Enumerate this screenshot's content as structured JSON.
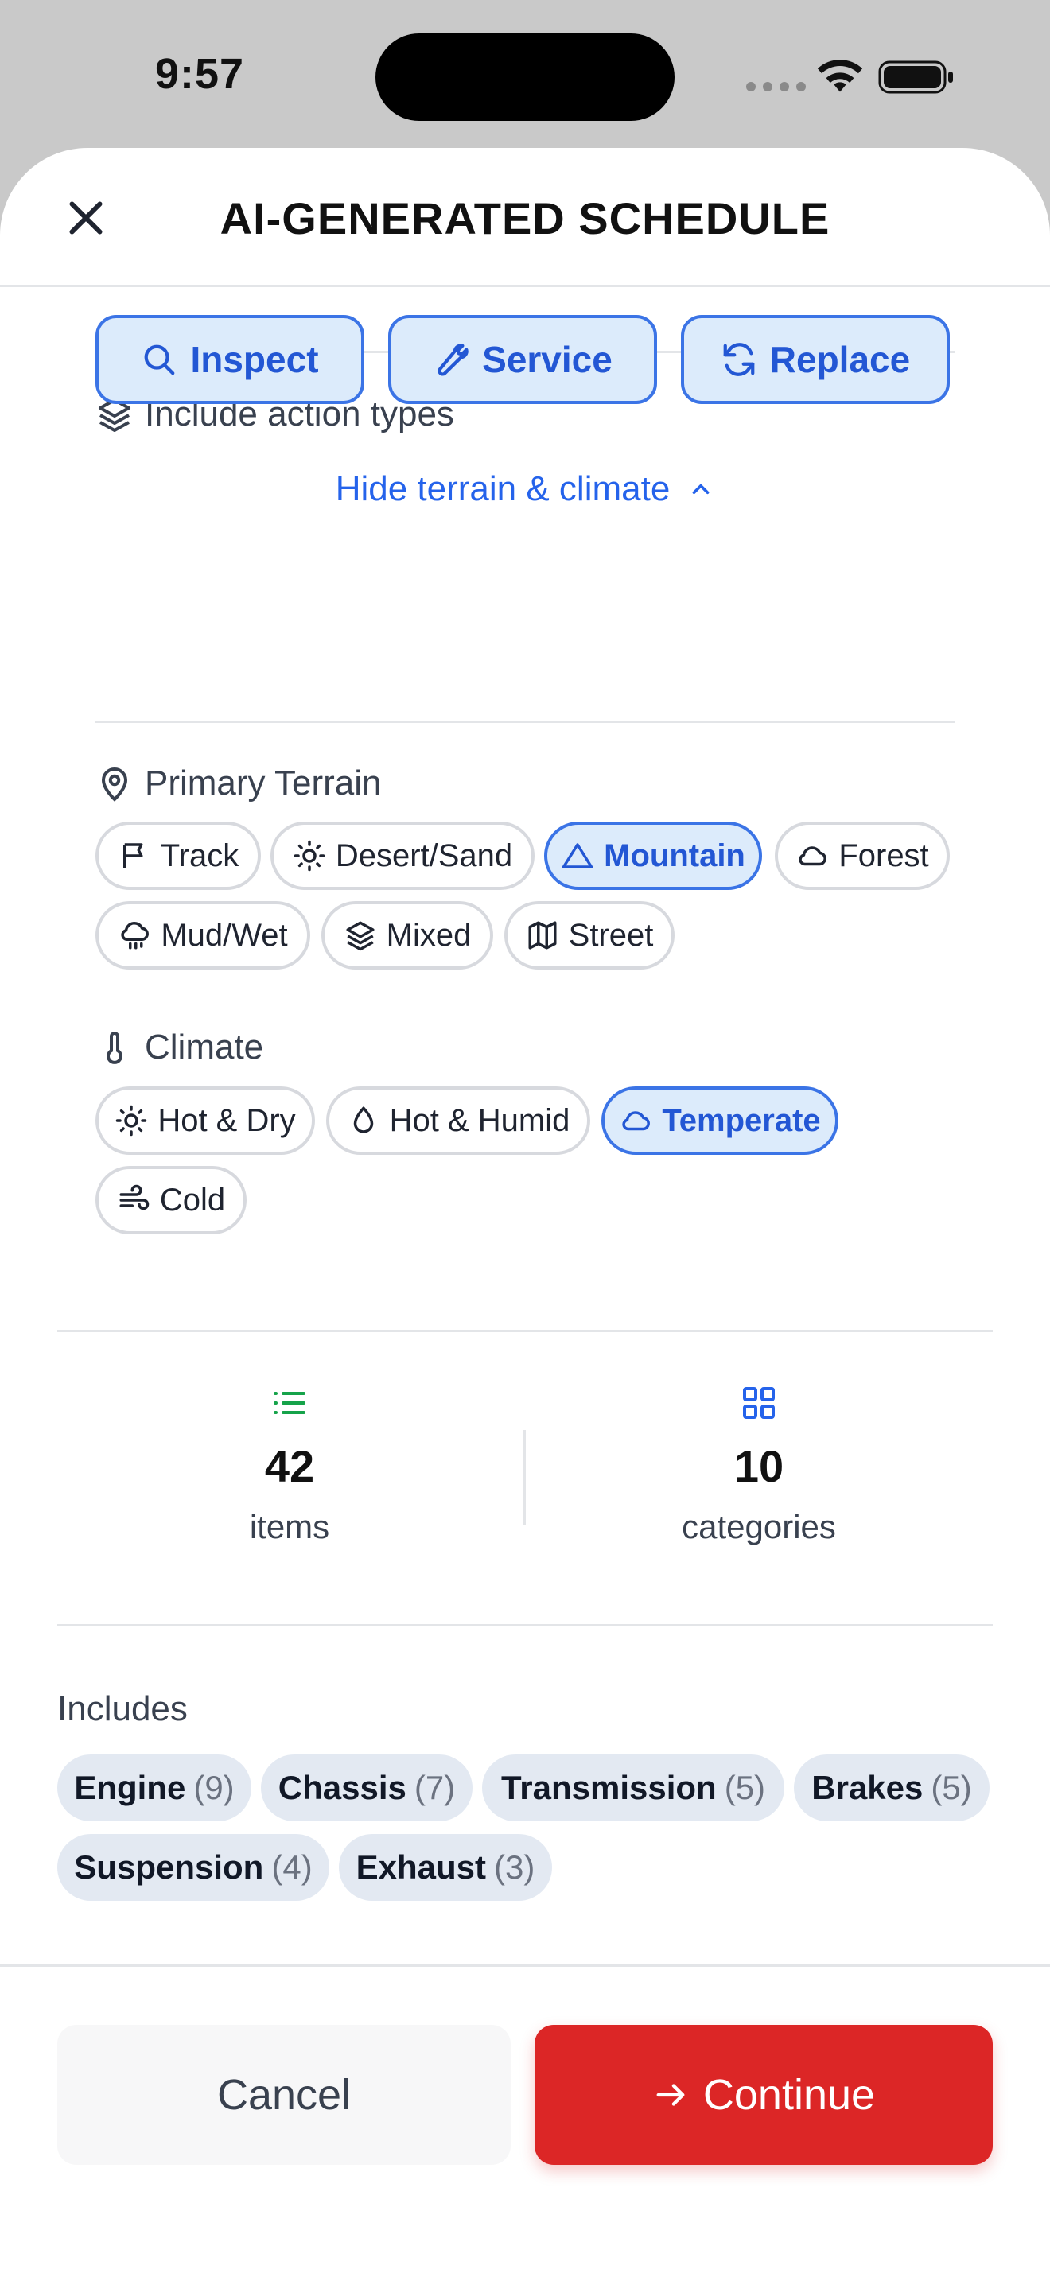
{
  "status_bar": {
    "time": "9:57"
  },
  "header": {
    "title": "AI-GENERATED SCHEDULE"
  },
  "action_types": {
    "label": "Include action types",
    "items": [
      {
        "label": "Inspect",
        "icon": "search-icon",
        "selected": true
      },
      {
        "label": "Service",
        "icon": "wrench-icon",
        "selected": true
      },
      {
        "label": "Replace",
        "icon": "refresh-icon",
        "selected": true
      }
    ]
  },
  "toggle": {
    "label": "Hide terrain & climate"
  },
  "terrain": {
    "label": "Primary Terrain",
    "items": [
      {
        "label": "Track",
        "icon": "flag-icon",
        "selected": false
      },
      {
        "label": "Desert/Sand",
        "icon": "sun-icon",
        "selected": false
      },
      {
        "label": "Mountain",
        "icon": "mountain-icon",
        "selected": true
      },
      {
        "label": "Forest",
        "icon": "cloud-icon",
        "selected": false
      },
      {
        "label": "Mud/Wet",
        "icon": "rain-icon",
        "selected": false
      },
      {
        "label": "Mixed",
        "icon": "layers-icon",
        "selected": false
      },
      {
        "label": "Street",
        "icon": "map-icon",
        "selected": false
      }
    ]
  },
  "climate": {
    "label": "Climate",
    "items": [
      {
        "label": "Hot & Dry",
        "icon": "sun-icon",
        "selected": false
      },
      {
        "label": "Hot & Humid",
        "icon": "droplet-icon",
        "selected": false
      },
      {
        "label": "Temperate",
        "icon": "cloud-icon",
        "selected": true
      },
      {
        "label": "Cold",
        "icon": "wind-icon",
        "selected": false
      }
    ]
  },
  "stats": {
    "items": {
      "value": "42",
      "label": "items"
    },
    "categories": {
      "value": "10",
      "label": "categories"
    }
  },
  "includes": {
    "label": "Includes",
    "tags": [
      {
        "name": "Engine",
        "count": "(9)"
      },
      {
        "name": "Chassis",
        "count": "(7)"
      },
      {
        "name": "Transmission",
        "count": "(5)"
      },
      {
        "name": "Brakes",
        "count": "(5)"
      },
      {
        "name": "Suspension",
        "count": "(4)"
      },
      {
        "name": "Exhaust",
        "count": "(3)"
      }
    ]
  },
  "footer": {
    "cancel_label": "Cancel",
    "continue_label": "Continue"
  },
  "colors": {
    "accent": "#2563eb",
    "primary_action": "#dc2626",
    "selected_bg": "#dcebfb"
  }
}
